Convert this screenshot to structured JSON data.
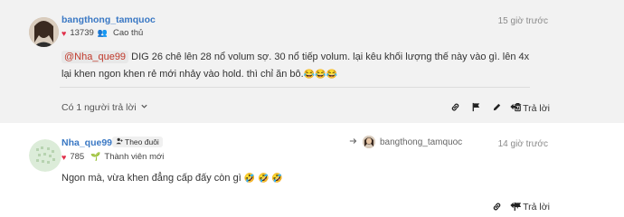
{
  "post1": {
    "username": "bangthong_tamquoc",
    "time": "15 giờ trước",
    "likes": "13739",
    "user_title": "Cao thủ",
    "mention": "@Nha_que99",
    "text_line1": " DIG 26 chê lên 28 nổ volum sợ. 30 nổ tiếp volum. lại kêu khối lượng thế này vào gì. lên 4x",
    "text_line2": "lại khen ngon khen rẻ mới nhảy vào hold. thì chỉ ăn bô.",
    "emojis": "😂😂😂",
    "replies_label": "Có 1 người trả lời",
    "reply_label": "Trả lời"
  },
  "post2": {
    "username": "Nha_que99",
    "follow_label": "Theo đuôi",
    "reply_to_user": "bangthong_tamquoc",
    "time": "14 giờ trước",
    "likes": "785",
    "user_title": "Thành viên mới",
    "text": "Ngon mà, vừa khen đẳng cấp đấy còn gì ",
    "emojis": "🤣 🤣 🤣",
    "reply_label": "Trả lời"
  },
  "icons": {
    "link": "link-icon",
    "flag": "flag-icon",
    "edit": "pencil-icon",
    "delete": "trash-icon",
    "reply": "reply-icon",
    "heart": "heart-icon"
  },
  "colors": {
    "username": "#3a78c4",
    "heart": "#e0304a",
    "mention": "#c0392b",
    "post_bg": "#f2f2f2"
  }
}
